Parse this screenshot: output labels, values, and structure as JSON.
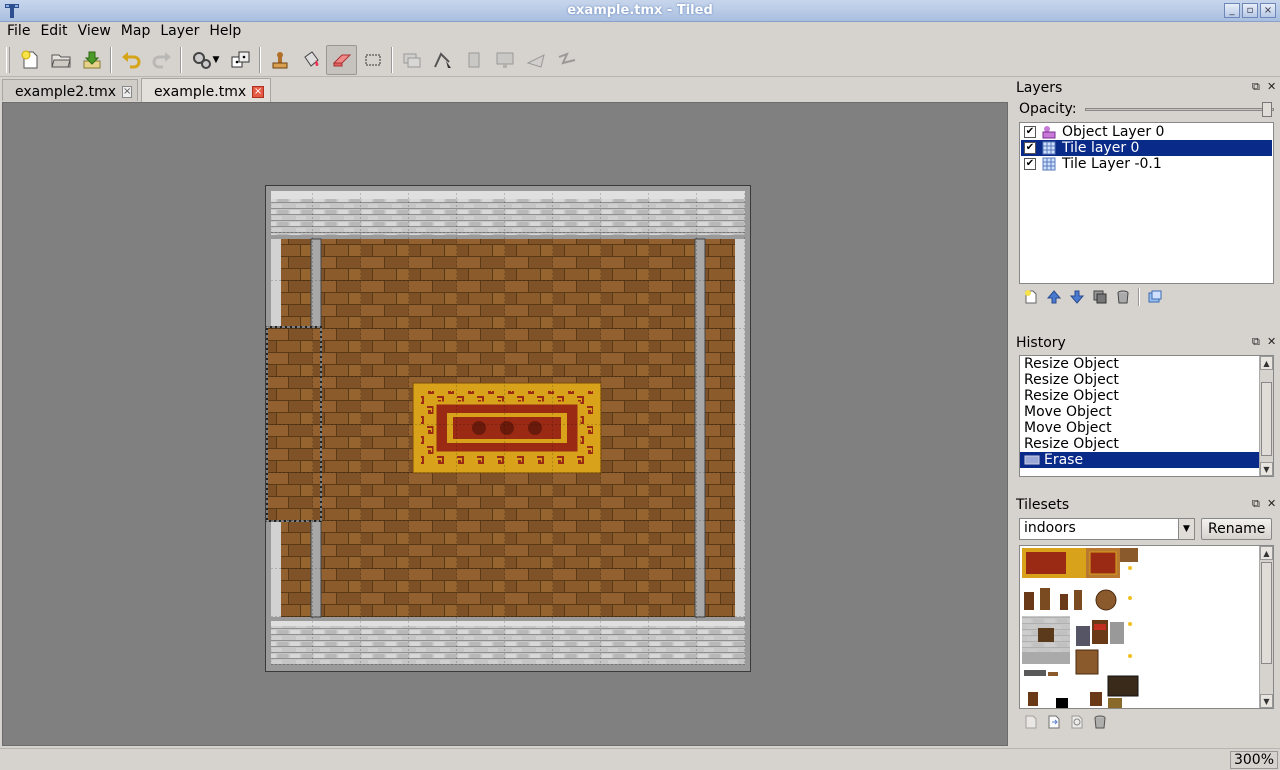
{
  "window": {
    "title": "example.tmx - Tiled",
    "buttons": [
      "_",
      "▫",
      "×"
    ]
  },
  "menu": [
    {
      "label": "File",
      "mnemonic": "F"
    },
    {
      "label": "Edit",
      "mnemonic": "E"
    },
    {
      "label": "View",
      "mnemonic": "V"
    },
    {
      "label": "Map",
      "mnemonic": "M"
    },
    {
      "label": "Layer",
      "mnemonic": "L"
    },
    {
      "label": "Help",
      "mnemonic": "H"
    }
  ],
  "toolbar": {
    "icons": [
      "new-icon",
      "open-icon",
      "save-icon",
      "undo-icon",
      "redo-icon",
      "map-properties-icon",
      "random-icon",
      "stamp-brush-icon",
      "bucket-fill-icon",
      "eraser-icon",
      "rectangle-select-icon",
      "select-objects-icon",
      "edit-polygons-icon",
      "insert-rectangle-icon",
      "insert-image-icon",
      "insert-polygon-icon",
      "insert-polyline-icon"
    ],
    "active_tool": "eraser"
  },
  "tabs": [
    {
      "label": "example2.tmx",
      "active": false
    },
    {
      "label": "example.tmx",
      "active": true
    }
  ],
  "layers_panel": {
    "title": "Layers",
    "opacity_label": "Opacity:",
    "opacity": 1.0,
    "items": [
      {
        "label": "Object Layer 0",
        "checked": true,
        "type": "object"
      },
      {
        "label": "Tile layer 0",
        "checked": true,
        "type": "tile",
        "selected": true
      },
      {
        "label": "Tile Layer -0.1",
        "checked": true,
        "type": "tile"
      }
    ]
  },
  "history_panel": {
    "title": "History",
    "items": [
      {
        "label": "Resize Object"
      },
      {
        "label": "Resize Object"
      },
      {
        "label": "Resize Object"
      },
      {
        "label": "Move Object"
      },
      {
        "label": "Move Object"
      },
      {
        "label": "Resize Object"
      },
      {
        "label": "Erase",
        "selected": true
      }
    ]
  },
  "tilesets_panel": {
    "title": "Tilesets",
    "selected_tileset": "indoors",
    "rename_label": "Rename"
  },
  "status": {
    "zoom": "300%"
  },
  "colors": {
    "selection": "#0a2a8a",
    "floor": "#8a5a2c",
    "wall": "#c9c9c9",
    "rug_gold": "#d8a21a",
    "rug_red": "#9b2a14"
  }
}
